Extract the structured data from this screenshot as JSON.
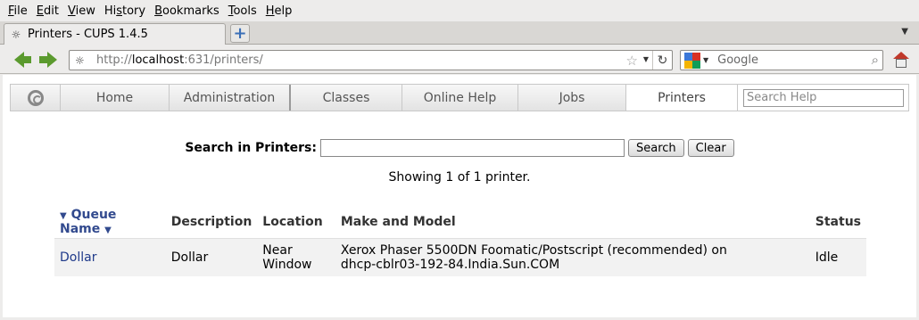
{
  "menu": {
    "items": [
      {
        "accel": "F",
        "rest": "ile"
      },
      {
        "accel": "E",
        "rest": "dit"
      },
      {
        "accel": "V",
        "rest": "iew"
      },
      {
        "pre": "Hi",
        "accel": "s",
        "rest": "tory"
      },
      {
        "accel": "B",
        "rest": "ookmarks"
      },
      {
        "accel": "T",
        "rest": "ools"
      },
      {
        "accel": "H",
        "rest": "elp"
      }
    ]
  },
  "tab": {
    "title": "Printers - CUPS 1.4.5"
  },
  "urlbar": {
    "scheme": "http://",
    "host": "localhost",
    "rest": ":631/printers/"
  },
  "searchbar": {
    "engine": "Google"
  },
  "cups_nav": {
    "items": [
      "Home",
      "Administration",
      "Classes",
      "Online Help",
      "Jobs",
      "Printers"
    ],
    "active": "Printers",
    "search_placeholder": "Search Help"
  },
  "search": {
    "label": "Search in Printers:",
    "value": "",
    "search_button": "Search",
    "clear_button": "Clear"
  },
  "showing": "Showing 1 of 1 printer.",
  "table": {
    "headers": {
      "queue_name": "Queue Name",
      "description": "Description",
      "location": "Location",
      "make_model": "Make and Model",
      "status": "Status"
    },
    "rows": [
      {
        "queue_name": "Dollar",
        "description": "Dollar",
        "location_line1": "Near",
        "location_line2": "Window",
        "make_model_line1": "Xerox Phaser 5500DN Foomatic/Postscript (recommended) on",
        "make_model_line2": "dhcp-cblr03-192-84.India.Sun.COM",
        "status": "Idle"
      }
    ]
  }
}
